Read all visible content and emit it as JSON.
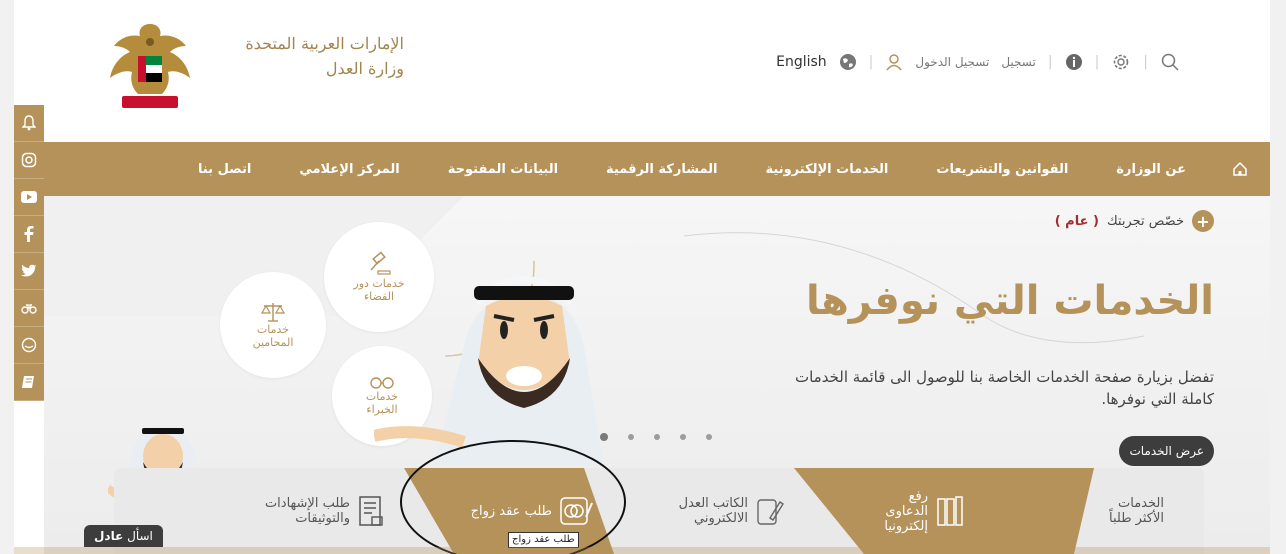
{
  "header": {
    "ministry_line1": "الإمارات العربية المتحدة",
    "ministry_line2": "وزارة العدل",
    "english": "English",
    "login": "تسجيل الدخول",
    "register": "تسجيل"
  },
  "icons": {
    "search": "search-icon",
    "settings": "gear-icon",
    "info": "info-icon",
    "user": "user-icon",
    "globe": "globe-icon"
  },
  "sidebar": [
    "bell",
    "instagram",
    "youtube",
    "facebook",
    "twitter",
    "binoculars",
    "chat",
    "book"
  ],
  "nav": {
    "items": [
      "عن الوزارة",
      "القوانين والتشريعات",
      "الخدمات الإلكترونية",
      "المشاركة الرقمية",
      "البيانات المفتوحة",
      "المركز الإعلامي",
      "اتصل بنا"
    ]
  },
  "hero": {
    "personalize_prefix": "خصّص تجربتك",
    "personalize_value": "( عام )",
    "title": "الخدمات التي نوفرها",
    "description": "تفضل بزيارة صفحة الخدمات الخاصة بنا للوصول الى قائمة الخدمات كاملة التي نوفرها.",
    "button": "عرض الخدمات",
    "circles": {
      "judiciary": "خدمات دور القضاء",
      "lawyers": "خدمات المحامين",
      "experts": "خدمات الخبراء"
    }
  },
  "services": {
    "most_requested": "الخدمات الأكثر طلباً",
    "lawsuits": "رفع الدعاوى إلكترونيا",
    "notary": "الكاتب العدل الالكتروني",
    "marriage": "طلب عقد زواج",
    "certificates": "طلب الإشهادات والتوثيقات"
  },
  "tooltip": "طلب عقد زواج",
  "ask": {
    "prefix": "اسأل",
    "name": "عادل"
  },
  "colors": {
    "gold": "#b5925a",
    "dark": "#3d3d3d"
  }
}
